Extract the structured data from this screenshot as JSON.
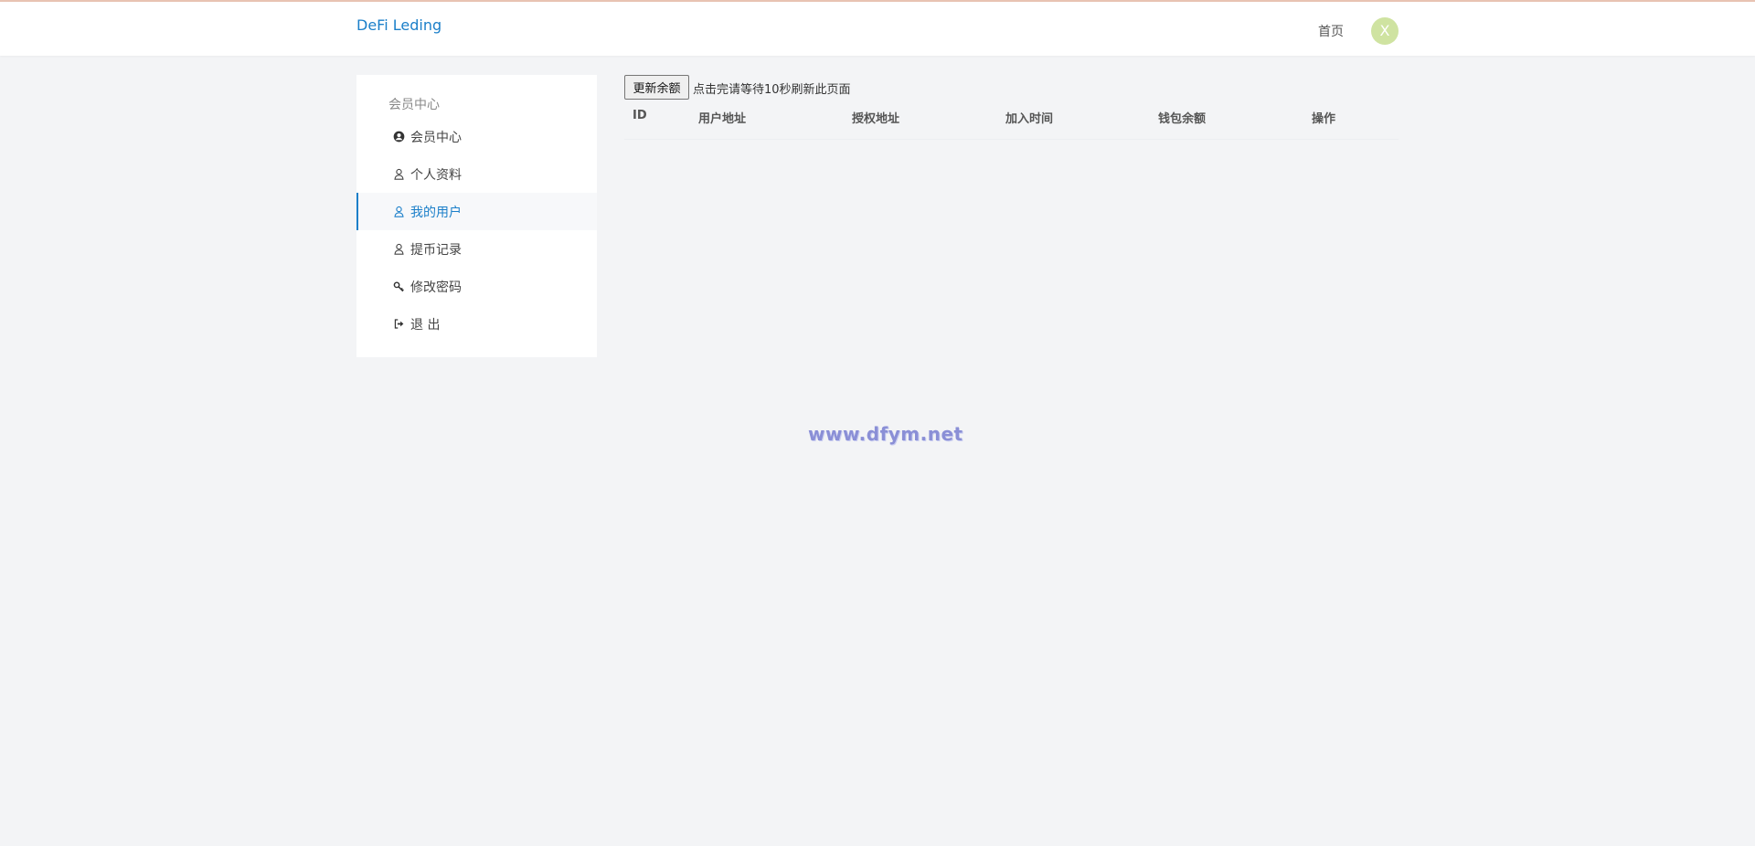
{
  "header": {
    "brand": "DeFi Leding",
    "nav_home": "首页",
    "avatar_letter": "X",
    "avatar_color": "#cfe3a1",
    "accent_color": "#1b7fc9"
  },
  "sidebar": {
    "title": "会员中心",
    "items": [
      {
        "label": "会员中心",
        "icon": "user-circle-icon",
        "active": false
      },
      {
        "label": "个人资料",
        "icon": "user-icon",
        "active": false
      },
      {
        "label": "我的用户",
        "icon": "user-icon",
        "active": true
      },
      {
        "label": "提币记录",
        "icon": "user-icon",
        "active": false
      },
      {
        "label": "修改密码",
        "icon": "key-icon",
        "active": false
      },
      {
        "label": "退 出",
        "icon": "sign-out-icon",
        "active": false
      }
    ]
  },
  "main": {
    "refresh_button": "更新余额",
    "refresh_note": "点击完请等待10秒刷新此页面",
    "table": {
      "columns": [
        "ID",
        "用户地址",
        "授权地址",
        "加入时间",
        "钱包余额",
        "操作"
      ],
      "rows": []
    }
  },
  "watermark": "www.dfym.net"
}
